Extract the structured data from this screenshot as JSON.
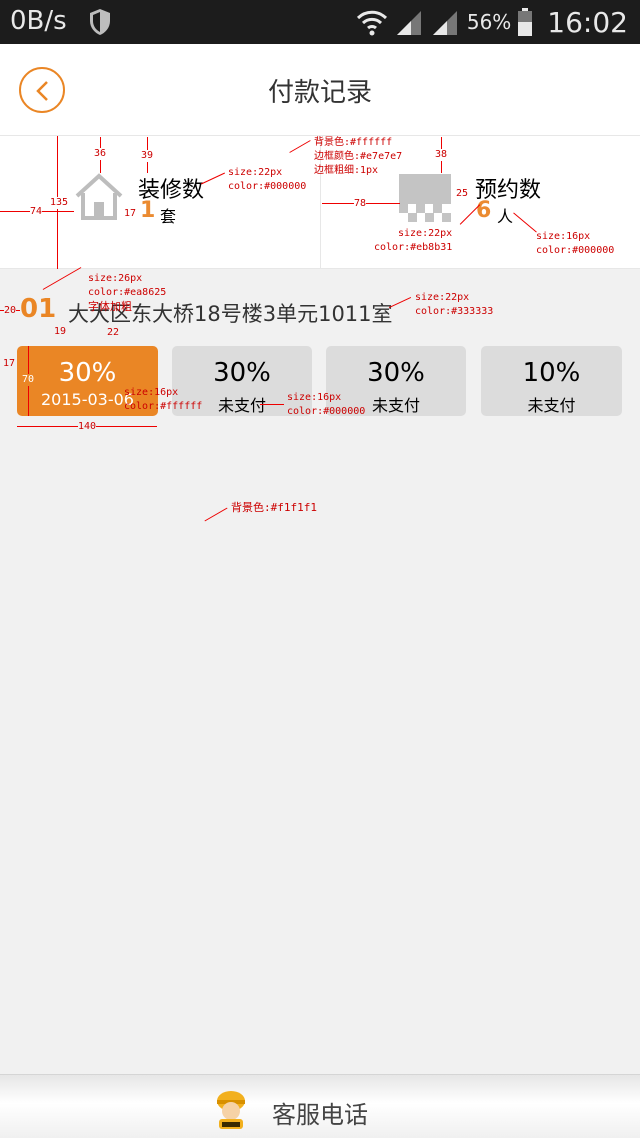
{
  "status_bar": {
    "speed": "0B/s",
    "battery_pct": "56%",
    "time": "16:02"
  },
  "header": {
    "title": "付款记录"
  },
  "stats": {
    "left": {
      "label": "装修数",
      "value": "1",
      "unit": "套"
    },
    "right": {
      "label": "预约数",
      "value": "6",
      "unit": "人"
    }
  },
  "address": {
    "number": "01",
    "text": "大大区东大桥18号楼3单元1011室"
  },
  "cards": [
    {
      "percent": "30%",
      "sub": "2015-03-06",
      "active": true
    },
    {
      "percent": "30%",
      "sub": "未支付",
      "active": false
    },
    {
      "percent": "30%",
      "sub": "未支付",
      "active": false
    },
    {
      "percent": "10%",
      "sub": "未支付",
      "active": false
    }
  ],
  "annotations": {
    "header_bg": "背景色:#ffffff",
    "header_border_color": "边框颜色:#e7e7e7",
    "header_border_width": "边框粗细:1px",
    "label_size": "size:22px",
    "label_color": "color:#000000",
    "num_size": "size:22px",
    "num_color": "color:#eb8b31",
    "unit_size": "size:16px",
    "unit_color": "color:#000000",
    "addr_num_size": "size:26px",
    "addr_num_color": "color:#ea8625",
    "addr_num_bold": "字体加粗",
    "addr_text_size": "size:22px",
    "addr_text_color": "color:#333333",
    "card_active_size": "size:16px",
    "card_active_color": "color:#ffffff",
    "card_size": "size:16px",
    "card_color": "color:#000000",
    "page_bg": "背景色:#f1f1f1",
    "dim_36": "36",
    "dim_39": "39",
    "dim_38": "38",
    "dim_135": "135",
    "dim_74": "74",
    "dim_17a": "17",
    "dim_78": "78",
    "dim_25": "25",
    "dim_20": "20",
    "dim_19": "19",
    "dim_22": "22",
    "dim_17b": "17",
    "dim_70": "70",
    "dim_140": "140"
  },
  "footer": {
    "label": "客服电话"
  },
  "colors": {
    "accent": "#ea8625",
    "num": "#eb8b31",
    "card_bg": "#dcdcdc",
    "page_bg": "#f1f1f1"
  }
}
